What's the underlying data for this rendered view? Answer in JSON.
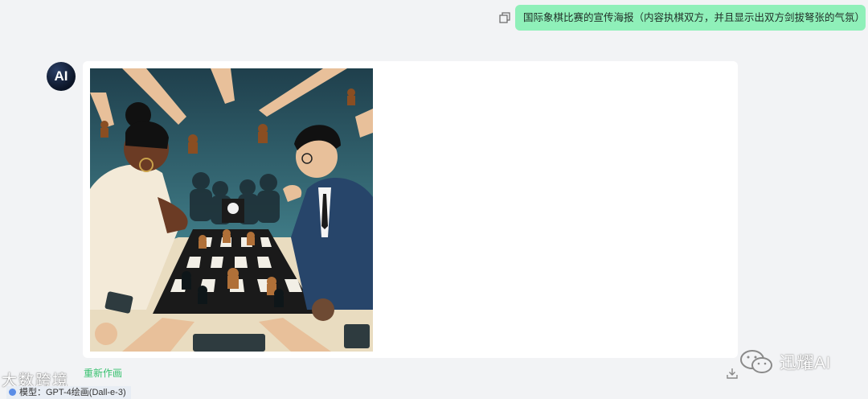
{
  "user_message": {
    "text": "国际象棋比赛的宣传海报（内容执棋双方，并且显示出双方剑拔弩张的气氛）",
    "copy_icon": "copy-icon"
  },
  "assistant": {
    "avatar_label": "AI",
    "image_alt": "Chess tournament poster illustration",
    "redraw_label": "重新作画",
    "download_icon": "download-icon"
  },
  "watermark": {
    "brand": "迅耀AI",
    "brand_icon": "wechat-icon",
    "secondary": "大数跨境"
  },
  "model_tag": {
    "label": "模型：GPT-4绘画(Dall-e-3)"
  },
  "colors": {
    "page_bg": "#f2f3f5",
    "user_bubble": "#8ff0b9",
    "accent_green": "#38c16f",
    "card_bg": "#ffffff"
  }
}
